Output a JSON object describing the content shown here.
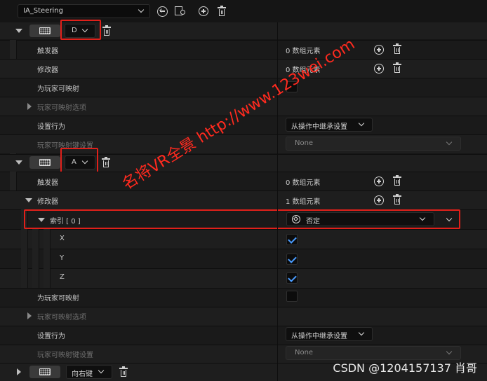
{
  "toolbar": {
    "asset_name": "IA_Steering"
  },
  "mappings": [
    {
      "key_label": "D",
      "triggers_label": "触发器",
      "triggers_value": "0 数组元素",
      "modifiers_label": "修改器",
      "modifiers_value": "0 数组元素",
      "player_mappable_label": "为玩家可映射",
      "player_mappable_options_label": "玩家可映射选项",
      "setting_behavior_label": "设置行为",
      "setting_behavior_value": "从操作中继承设置",
      "player_mappable_key_settings_label": "玩家可映射键设置",
      "player_mappable_key_settings_value": "None"
    },
    {
      "key_label": "A",
      "triggers_label": "触发器",
      "triggers_value": "0 数组元素",
      "modifiers_label": "修改器",
      "modifiers_value": "1 数组元素",
      "index_label": "索引 [ 0 ]",
      "index_value": "否定",
      "x_label": "X",
      "y_label": "Y",
      "z_label": "Z",
      "x_checked": true,
      "y_checked": true,
      "z_checked": true,
      "player_mappable_label": "为玩家可映射",
      "player_mappable_options_label": "玩家可映射选项",
      "setting_behavior_label": "设置行为",
      "setting_behavior_value": "从操作中继承设置",
      "player_mappable_key_settings_label": "玩家可映射键设置",
      "player_mappable_key_settings_value": "None"
    },
    {
      "key_label": "向右键"
    }
  ],
  "watermark": {
    "diagonal_text": "名将VR全景 http://www.123wei.com",
    "corner_text": "CSDN @1204157137 肖哥"
  },
  "colors": {
    "highlight_box": "#e0201a",
    "check_blue": "#4a9cff",
    "panel_bg": "#1a1a1a"
  }
}
